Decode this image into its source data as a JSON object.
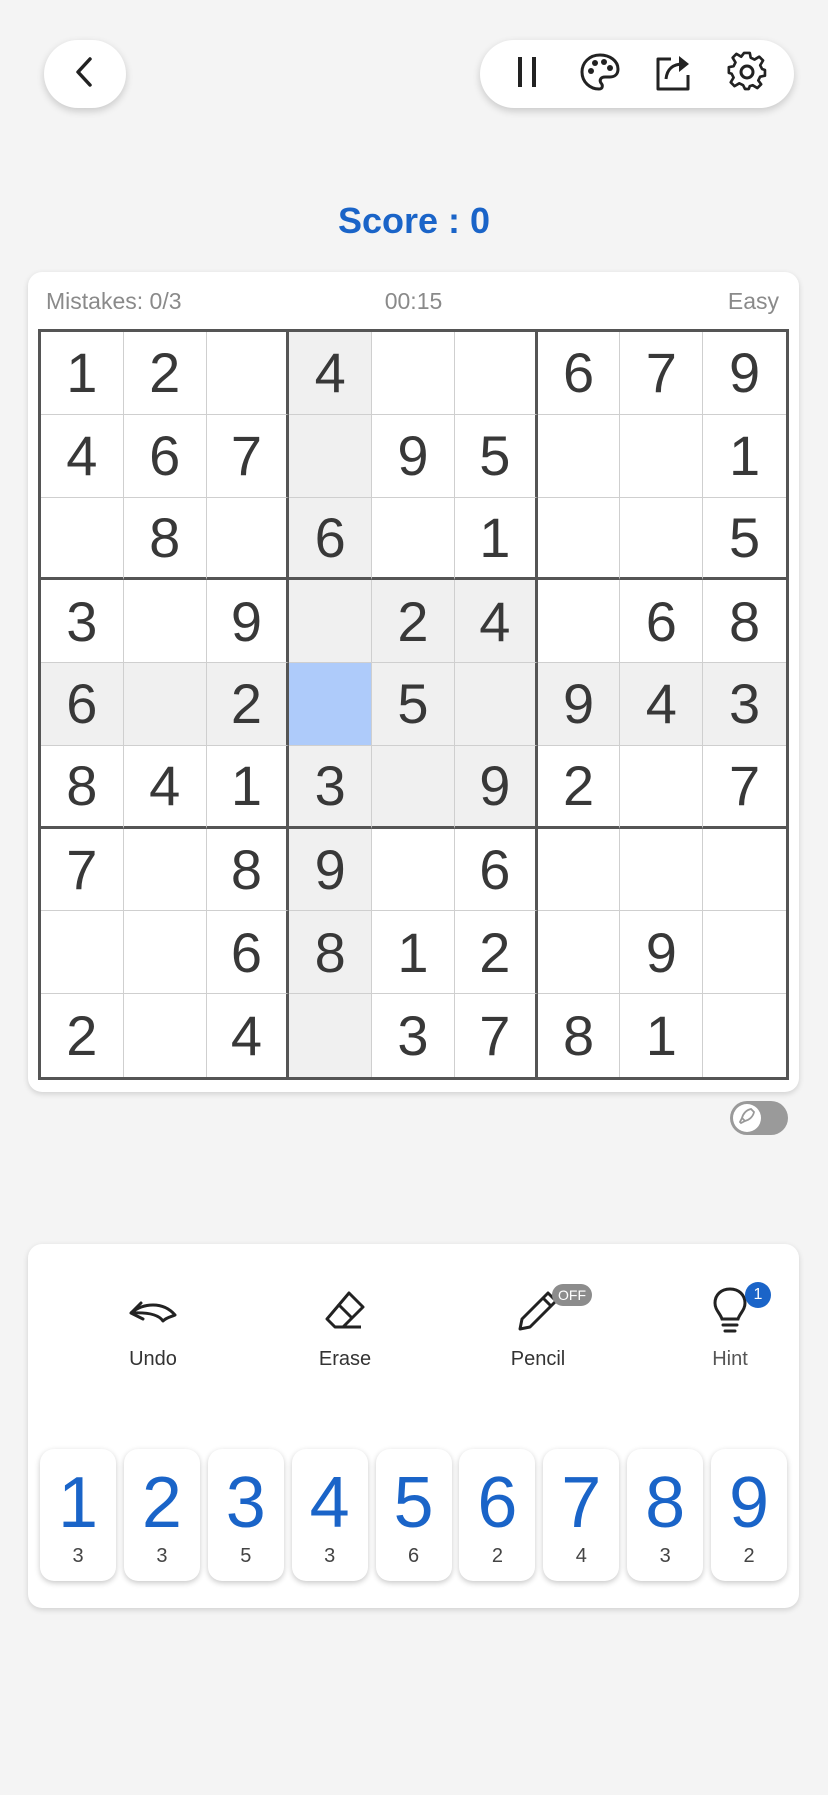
{
  "header": {
    "back_icon": "chevron-left-icon",
    "actions": [
      {
        "name": "pause-button",
        "icon": "pause-icon"
      },
      {
        "name": "theme-button",
        "icon": "palette-icon"
      },
      {
        "name": "share-button",
        "icon": "share-icon"
      },
      {
        "name": "settings-button",
        "icon": "gear-icon"
      }
    ]
  },
  "score": {
    "label": "Score : 0"
  },
  "board": {
    "mistakes": "Mistakes: 0/3",
    "timer": "00:15",
    "difficulty": "Easy",
    "selected": [
      4,
      3
    ],
    "highlight_color": "#f0f0f0",
    "selected_color": "#aecbfa",
    "rows": [
      [
        "1",
        "2",
        "",
        "4",
        "",
        "",
        "6",
        "7",
        "9"
      ],
      [
        "4",
        "6",
        "7",
        "",
        "9",
        "5",
        "",
        "",
        "1"
      ],
      [
        "",
        "8",
        "",
        "6",
        "",
        "1",
        "",
        "",
        "5"
      ],
      [
        "3",
        "",
        "9",
        "",
        "2",
        "4",
        "",
        "6",
        "8"
      ],
      [
        "6",
        "",
        "2",
        "",
        "5",
        "",
        "9",
        "4",
        "3"
      ],
      [
        "8",
        "4",
        "1",
        "3",
        "",
        "9",
        "2",
        "",
        "7"
      ],
      [
        "7",
        "",
        "8",
        "9",
        "",
        "6",
        "",
        "",
        ""
      ],
      [
        "",
        "",
        "6",
        "8",
        "1",
        "2",
        "",
        "9",
        ""
      ],
      [
        "2",
        "",
        "4",
        "",
        "3",
        "7",
        "8",
        "1",
        ""
      ]
    ]
  },
  "toggle": {
    "icon": "rocket-icon",
    "on": false
  },
  "tools": {
    "undo": {
      "label": "Undo",
      "icon": "undo-icon"
    },
    "erase": {
      "label": "Erase",
      "icon": "eraser-icon"
    },
    "pencil": {
      "label": "Pencil",
      "icon": "pencil-icon",
      "badge": "OFF"
    },
    "hint": {
      "label": "Hint",
      "icon": "lightbulb-icon",
      "badge": "1"
    }
  },
  "numpad": [
    {
      "digit": "1",
      "remaining": "3"
    },
    {
      "digit": "2",
      "remaining": "3"
    },
    {
      "digit": "3",
      "remaining": "5"
    },
    {
      "digit": "4",
      "remaining": "3"
    },
    {
      "digit": "5",
      "remaining": "6"
    },
    {
      "digit": "6",
      "remaining": "2"
    },
    {
      "digit": "7",
      "remaining": "4"
    },
    {
      "digit": "8",
      "remaining": "3"
    },
    {
      "digit": "9",
      "remaining": "2"
    }
  ],
  "colors": {
    "accent": "#1a64c8",
    "badge_gray": "#8c8c8c"
  }
}
